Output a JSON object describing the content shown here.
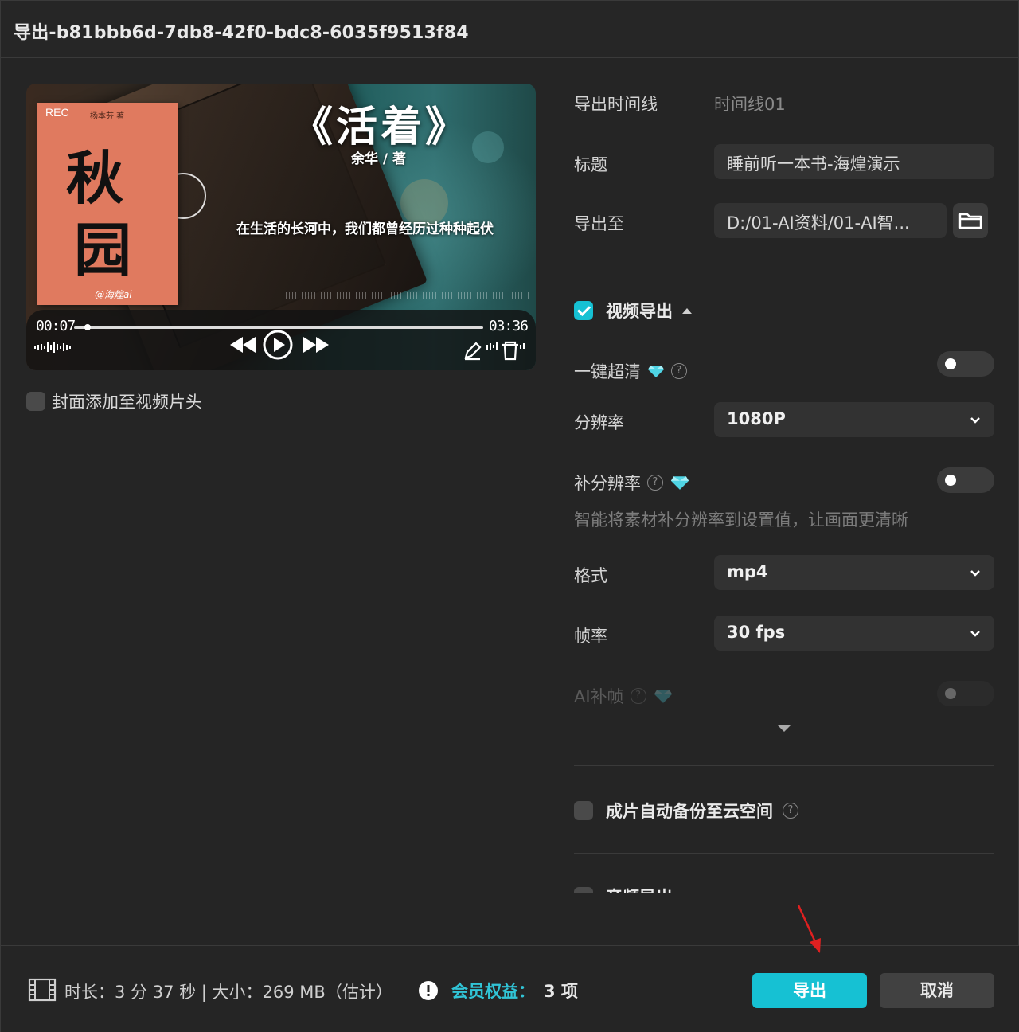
{
  "window": {
    "title": "导出-b81bbb6d-7db8-42f0-bdc8-6035f9513f84"
  },
  "preview": {
    "cover": {
      "rec": "REC",
      "author": "杨本芬 著",
      "big_char_1": "秋",
      "big_char_2": "园",
      "signature": "@海煌ai"
    },
    "video_title": "《活着》",
    "video_author": "余华 / 著",
    "quote": "在生活的长河中，我们都曾经历过种种起伏",
    "player": {
      "current_time": "00:07",
      "total_time": "03:36",
      "progress": 0.034
    }
  },
  "cover_option": {
    "label": "封面添加至视频片头",
    "checked": false
  },
  "form": {
    "timeline": {
      "label": "导出时间线",
      "value": "时间线01"
    },
    "title": {
      "label": "标题",
      "value": "睡前听一本书-海煌演示"
    },
    "export_to": {
      "label": "导出至",
      "value": "D:/01-AI资料/01-AI智..."
    },
    "video_export": {
      "label": "视频导出",
      "checked": true,
      "icon": "caret-up-icon"
    },
    "one_click_hd": {
      "label": "一键超清",
      "enabled": false
    },
    "resolution": {
      "label": "分辨率",
      "value": "1080P"
    },
    "supplement_resolution": {
      "label": "补分辨率",
      "enabled": false,
      "hint": "智能将素材补分辨率到设置值，让画面更清晰"
    },
    "format": {
      "label": "格式",
      "value": "mp4"
    },
    "frame_rate": {
      "label": "帧率",
      "value": "30 fps"
    },
    "ai_frame": {
      "label": "AI补帧",
      "enabled": false
    },
    "cloud_backup": {
      "label": "成片自动备份至云空间",
      "checked": false
    },
    "audio_export": {
      "label": "音频导出",
      "checked": false
    }
  },
  "footer": {
    "info": "时长：3 分 37 秒 | 大小：269 MB（估计）",
    "member_label": "会员权益：",
    "member_count": "3 项",
    "export_button": "导出",
    "cancel_button": "取消"
  },
  "colors": {
    "accent": "#16c1d3",
    "background": "#252525",
    "field": "#323232",
    "annotation_arrow": "#e02020"
  }
}
